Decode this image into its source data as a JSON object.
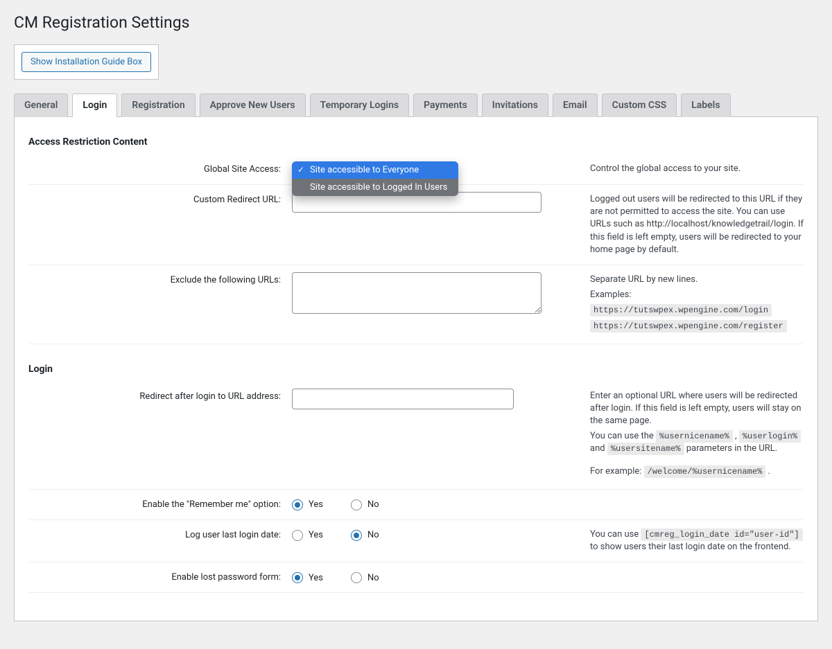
{
  "page_title": "CM Registration Settings",
  "guide_button": "Show Installation Guide Box",
  "tabs": [
    "General",
    "Login",
    "Registration",
    "Approve New Users",
    "Temporary Logins",
    "Payments",
    "Invitations",
    "Email",
    "Custom CSS",
    "Labels"
  ],
  "active_tab_index": 1,
  "sections": {
    "access": {
      "heading": "Access Restriction Content",
      "global_access": {
        "label": "Global Site Access:",
        "options": [
          "Site accessible to Everyone",
          "Site accessible to Logged In Users"
        ],
        "help": "Control the global access to your site."
      },
      "redirect_url": {
        "label": "Custom Redirect URL:",
        "value": "",
        "help": "Logged out users will be redirected to this URL if they are not permitted to access the site. You can use URLs such as http://localhost/knowledgetrail/login. If this field is left empty, users will be redirected to your home page by default."
      },
      "exclude_urls": {
        "label": "Exclude the following URLs:",
        "value": "",
        "help_intro": "Separate URL by new lines.",
        "help_examples_label": "Examples:",
        "help_examples": [
          "https://tutswpex.wpengine.com/login",
          "https://tutswpex.wpengine.com/register"
        ]
      }
    },
    "login": {
      "heading": "Login",
      "redirect_after_login": {
        "label": "Redirect after login to URL address:",
        "value": "",
        "help_line1": "Enter an optional URL where users will be redirected after login. If this field is left empty, users will stay on the same page.",
        "help_line2_pre": "You can use the ",
        "help_params": [
          "%usernicename%",
          "%userlogin%",
          "%usersitename%"
        ],
        "help_line2_mid": " , ",
        "help_line2_and": " and ",
        "help_line2_post": " parameters in the URL.",
        "help_example_label": "For example: ",
        "help_example_code": "/welcome/%usernicename%"
      },
      "remember_me": {
        "label": "Enable the \"Remember me\" option:",
        "yes": "Yes",
        "no": "No",
        "value": "yes"
      },
      "last_login": {
        "label": "Log user last login date:",
        "yes": "Yes",
        "no": "No",
        "value": "no",
        "help_pre": "You can use ",
        "help_code": "[cmreg_login_date id=\"user-id\"]",
        "help_post": " to show users their last login date on the frontend."
      },
      "lost_password": {
        "label": "Enable lost password form:",
        "yes": "Yes",
        "no": "No",
        "value": "yes"
      }
    }
  }
}
